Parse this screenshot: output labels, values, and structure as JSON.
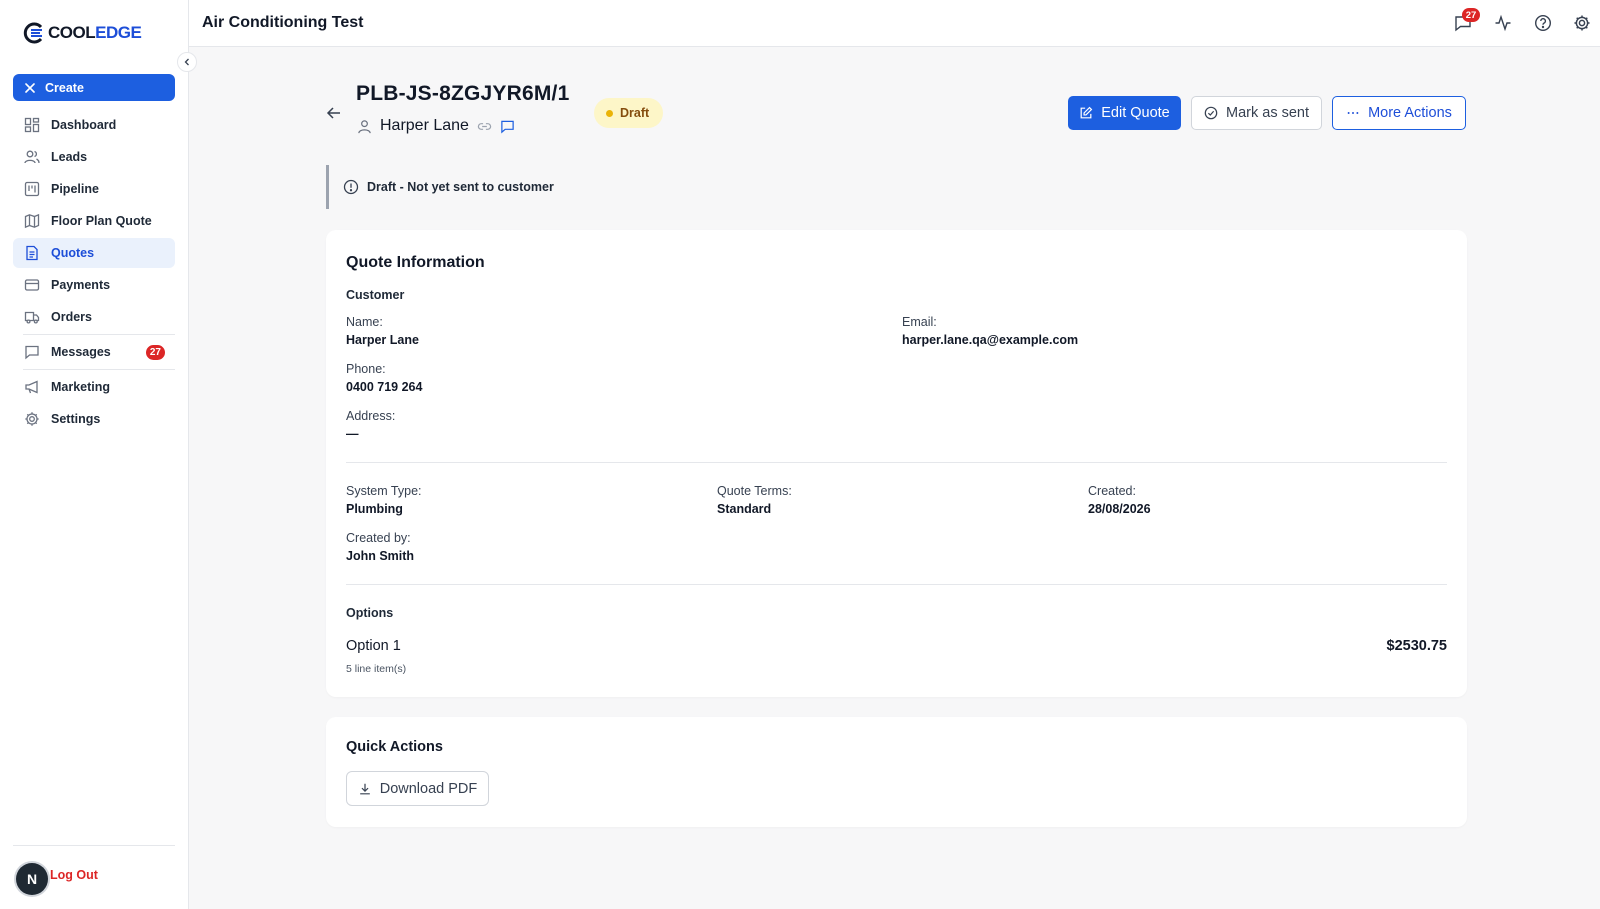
{
  "brand": {
    "name_part1": "COOL",
    "name_part2": "EDGE"
  },
  "sidebar": {
    "create_label": "Create",
    "items": [
      {
        "label": "Dashboard",
        "icon": "grid-icon"
      },
      {
        "label": "Leads",
        "icon": "users-icon"
      },
      {
        "label": "Pipeline",
        "icon": "kanban-icon"
      },
      {
        "label": "Floor Plan Quote",
        "icon": "map-icon"
      },
      {
        "label": "Quotes",
        "icon": "document-icon"
      },
      {
        "label": "Payments",
        "icon": "credit-card-icon"
      },
      {
        "label": "Orders",
        "icon": "truck-icon"
      },
      {
        "label": "Messages",
        "icon": "message-icon",
        "badge": "27"
      },
      {
        "label": "Marketing",
        "icon": "megaphone-icon"
      },
      {
        "label": "Settings",
        "icon": "gear-icon"
      }
    ],
    "avatar_initial": "N",
    "logout_label": "Log Out"
  },
  "topbar": {
    "title": "Air Conditioning Test",
    "notification_count": "27"
  },
  "header": {
    "quote_id": "PLB-JS-8ZGJYR6M/1",
    "customer_name": "Harper Lane",
    "status": "Draft",
    "edit_label": "Edit Quote",
    "mark_sent_label": "Mark as sent",
    "more_actions_label": "More Actions"
  },
  "notice": {
    "text": "Draft - Not yet sent to customer"
  },
  "quote_info": {
    "title": "Quote Information",
    "customer_section": "Customer",
    "name_label": "Name:",
    "name_value": "Harper Lane",
    "email_label": "Email:",
    "email_value": "harper.lane.qa@example.com",
    "phone_label": "Phone:",
    "phone_value": "0400 719 264",
    "address_label": "Address:",
    "address_value": "—",
    "system_type_label": "System Type:",
    "system_type_value": "Plumbing",
    "quote_terms_label": "Quote Terms:",
    "quote_terms_value": "Standard",
    "created_label": "Created:",
    "created_value": "28/08/2026",
    "created_by_label": "Created by:",
    "created_by_value": "John Smith",
    "options_section": "Options",
    "option_name": "Option 1",
    "option_items": "5 line item(s)",
    "option_price": "$2530.75"
  },
  "quick_actions": {
    "title": "Quick Actions",
    "download_label": "Download PDF"
  },
  "colors": {
    "primary": "#1d5fe0",
    "badge_red": "#dc2626",
    "draft_bg": "#fdf6c8",
    "draft_text": "#854d0e"
  }
}
